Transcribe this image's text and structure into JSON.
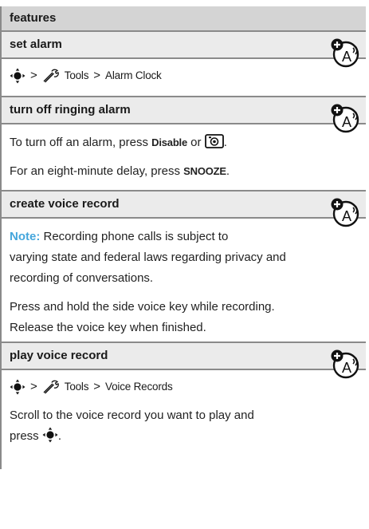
{
  "header": {
    "title": "features"
  },
  "sections": {
    "set_alarm": {
      "title": "set alarm",
      "nav": {
        "sep1": ">",
        "menu": "Tools",
        "sep2": ">",
        "item": "Alarm Clock"
      }
    },
    "turn_off": {
      "title": "turn off ringing alarm",
      "line1_pre": "To turn off an alarm, press",
      "line1_key": "Disable",
      "line1_or": "or",
      "line1_end": ".",
      "line2_pre": "For an eight-minute delay, press",
      "line2_key": "SNOOZE",
      "line2_end": "."
    },
    "create_voice": {
      "title": "create voice record",
      "note_label": "Note:",
      "note_l1": "Recording phone calls is subject to",
      "note_l2": "varying state and federal laws regarding privacy and",
      "note_l3": "recording of conversations.",
      "para_l1": "Press and hold the side voice key while recording.",
      "para_l2": "Release the voice key when finished."
    },
    "play_voice": {
      "title": "play voice record",
      "nav": {
        "sep1": ">",
        "menu": "Tools",
        "sep2": ">",
        "item": "Voice Records"
      },
      "line1": "Scroll to the voice record you want to play and",
      "line2_pre": "press",
      "line2_end": "."
    }
  },
  "icons": [
    "network-feature-icon",
    "nav-key-icon",
    "tools-icon",
    "camera-key-icon"
  ],
  "colors": {
    "note": "#45a6dc",
    "rule": "#8a8a8a",
    "header_bg": "#d4d4d4",
    "section_bg": "#ebebeb"
  }
}
